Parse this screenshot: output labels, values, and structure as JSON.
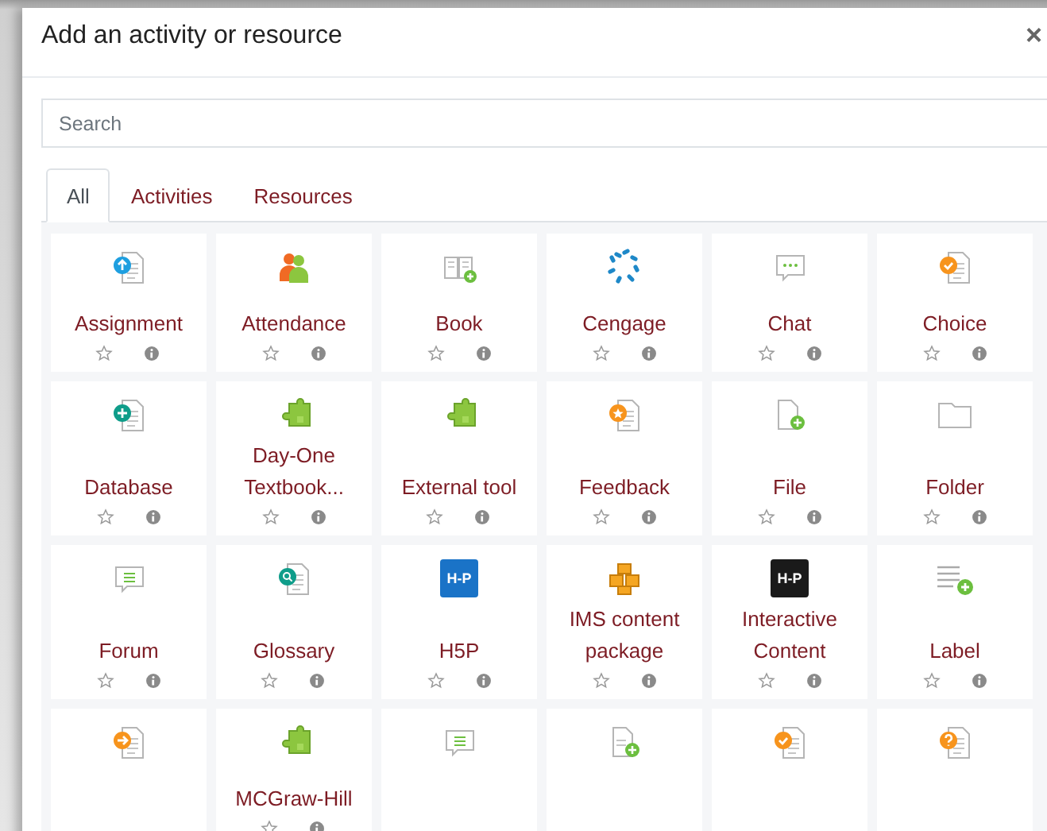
{
  "dialog": {
    "title": "Add an activity or resource",
    "close": "×"
  },
  "search": {
    "placeholder": "Search"
  },
  "tabs": [
    {
      "label": "All",
      "selected": true
    },
    {
      "label": "Activities",
      "selected": false
    },
    {
      "label": "Resources",
      "selected": false
    }
  ],
  "items": [
    {
      "label": "Assignment"
    },
    {
      "label": "Attendance"
    },
    {
      "label": "Book"
    },
    {
      "label": "Cengage"
    },
    {
      "label": "Chat"
    },
    {
      "label": "Choice"
    },
    {
      "label": "Database"
    },
    {
      "label": "Day-One Textbook..."
    },
    {
      "label": "External tool"
    },
    {
      "label": "Feedback"
    },
    {
      "label": "File"
    },
    {
      "label": "Folder"
    },
    {
      "label": "Forum"
    },
    {
      "label": "Glossary"
    },
    {
      "label": "H5P",
      "logo_text": "H-P"
    },
    {
      "label": "IMS content package"
    },
    {
      "label": "Interactive Content",
      "logo_text": "H-P"
    },
    {
      "label": "Label"
    },
    {
      "kind": "activity"
    },
    {
      "label": "MCGraw-Hill"
    },
    {
      "kind": "activity"
    },
    {
      "kind": "activity"
    },
    {
      "kind": "activity"
    },
    {
      "kind": "activity"
    }
  ]
}
